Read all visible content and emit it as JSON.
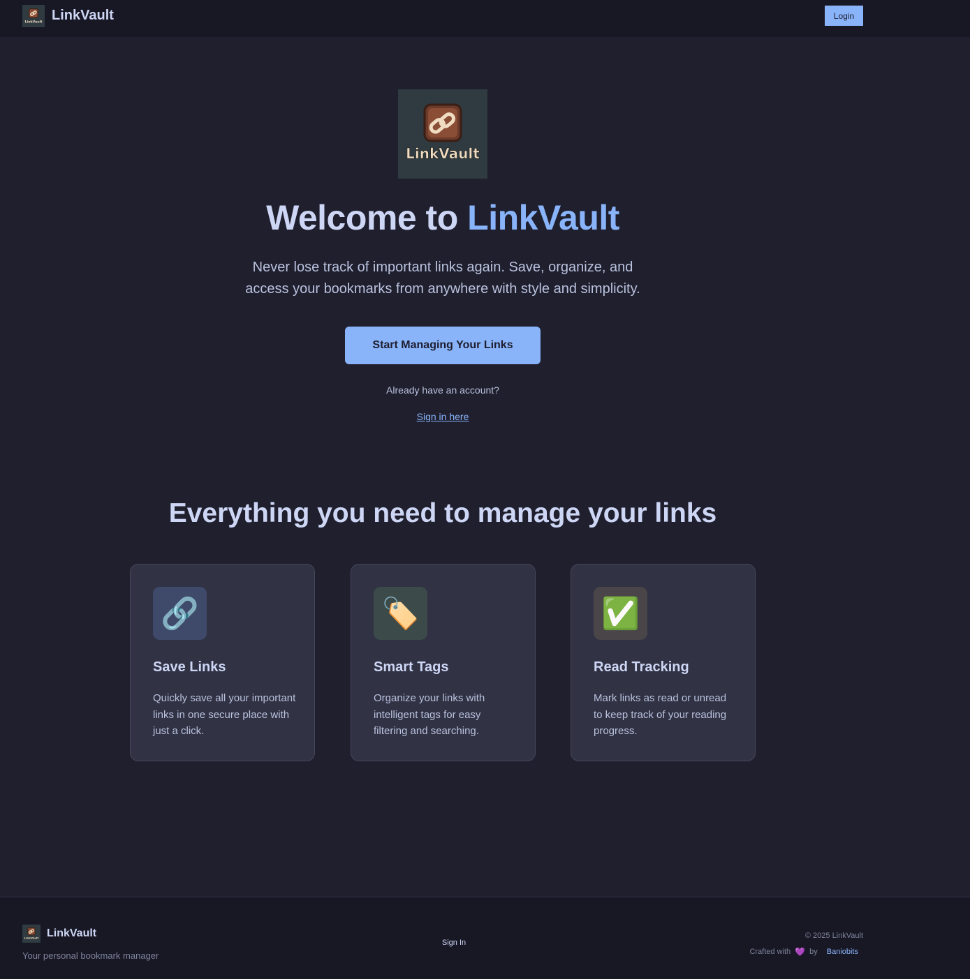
{
  "nav": {
    "brand": "LinkVault",
    "login_label": "Login"
  },
  "logo": {
    "text": "LinkVault",
    "icon": "chain-link-icon"
  },
  "hero": {
    "title_prefix": "Welcome to ",
    "title_accent": "LinkVault",
    "subtitle": "Never lose track of important links again. Save, organize, and access your bookmarks from anywhere with style and simplicity.",
    "cta_label": "Start Managing Your Links",
    "already_text": "Already have an account?",
    "signin_label": "Sign in here"
  },
  "features": {
    "title": "Everything you need to manage your links",
    "cards": [
      {
        "icon": "link-icon",
        "glyph": "🔗",
        "title": "Save Links",
        "desc": "Quickly save all your important links in one secure place with just a click."
      },
      {
        "icon": "tag-icon",
        "glyph": "🏷️",
        "title": "Smart Tags",
        "desc": "Organize your links with intelligent tags for easy filtering and searching."
      },
      {
        "icon": "check-icon",
        "glyph": "✅",
        "title": "Read Tracking",
        "desc": "Mark links as read or unread to keep track of your reading progress."
      }
    ]
  },
  "footer": {
    "brand": "LinkVault",
    "tagline": "Your personal bookmark manager",
    "signin_label": "Sign In",
    "copyright": "© 2025 LinkVault",
    "crafted_prefix": "Crafted with",
    "heart": "💜",
    "crafted_by": "by",
    "author": "Baniobits"
  },
  "colors": {
    "background": "#1f1f2e",
    "navbar": "#181825",
    "accent": "#89b4fa",
    "card": "#313244"
  }
}
